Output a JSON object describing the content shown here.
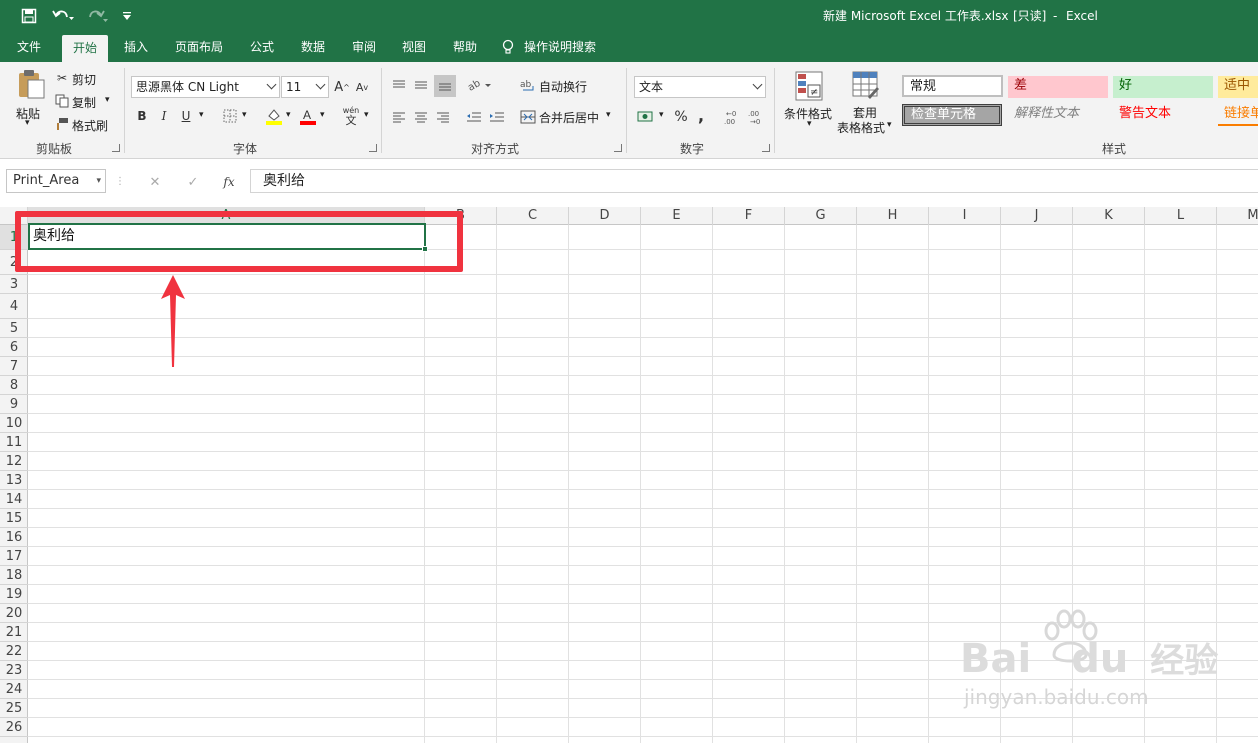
{
  "titlebar": {
    "document": "新建 Microsoft Excel 工作表.xlsx",
    "readonly": "[只读]",
    "separator": "-",
    "app": "Excel"
  },
  "tabs": [
    "文件",
    "开始",
    "插入",
    "页面布局",
    "公式",
    "数据",
    "审阅",
    "视图",
    "帮助"
  ],
  "tell_me": "操作说明搜索",
  "ribbon": {
    "clipboard": {
      "paste": "粘贴",
      "cut": "剪切",
      "copy": "复制",
      "format_painter": "格式刷",
      "label": "剪贴板"
    },
    "font": {
      "family": "思源黑体 CN Light",
      "size": "11",
      "label": "字体",
      "bold": "B",
      "italic": "I",
      "underline": "U",
      "wen": "wén",
      "wen_char": "文"
    },
    "alignment": {
      "wrap": "自动换行",
      "merge": "合并后居中",
      "label": "对齐方式"
    },
    "number": {
      "format": "文本",
      "percent": "%",
      "comma": ",",
      "label": "数字"
    },
    "styles": {
      "conditional": "条件格式",
      "table_line1": "套用",
      "table_line2": "表格格式",
      "label": "样式",
      "cells": [
        {
          "text": "常规",
          "bg": "#ffffff",
          "color": "#222222"
        },
        {
          "text": "差",
          "bg": "#ffc7ce",
          "color": "#9c0006"
        },
        {
          "text": "好",
          "bg": "#c6efce",
          "color": "#006100"
        },
        {
          "text": "适中",
          "bg": "#ffeb9c",
          "color": "#9c5700"
        },
        {
          "text": "检查单元格",
          "bg": "#a5a5a5",
          "color": "#ffffff"
        },
        {
          "text": "解释性文本",
          "bg": "#f3f3f3",
          "color": "#7f7f7f"
        },
        {
          "text": "警告文本",
          "bg": "#f3f3f3",
          "color": "#ff0000"
        },
        {
          "text": "链接单",
          "bg": "#f3f3f3",
          "color": "#fa7d00"
        }
      ]
    }
  },
  "formula_bar": {
    "name_box": "Print_Area",
    "fx": "fx",
    "cancel": "✕",
    "enter": "✓",
    "value": "奥利给"
  },
  "grid": {
    "columns": [
      "A",
      "B",
      "C",
      "D",
      "E",
      "F",
      "G",
      "H",
      "I",
      "J",
      "K",
      "L",
      "M"
    ],
    "rows": [
      "1",
      "2",
      "3",
      "4",
      "5",
      "6",
      "7",
      "8",
      "9",
      "10",
      "11",
      "12",
      "13",
      "14",
      "15",
      "16",
      "17",
      "18",
      "19",
      "20",
      "21",
      "22",
      "23",
      "24",
      "25",
      "26"
    ],
    "a1": "奥利给"
  },
  "watermark": {
    "brand": "Bai",
    "du": "du",
    "jingyan": "经验",
    "url": "jingyan.baidu.com"
  },
  "colors": {
    "excel_green": "#217346",
    "annotation_red": "#f0333f"
  }
}
